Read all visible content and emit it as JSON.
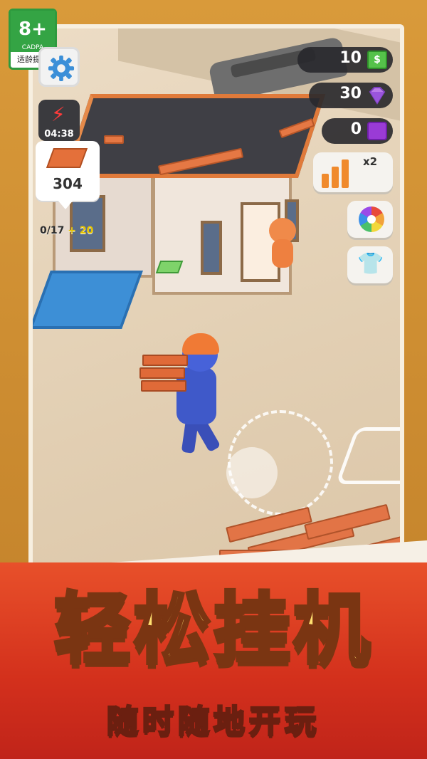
{
  "rating_badge": {
    "age": "8+",
    "org": "CADPA",
    "label": "适龄提示"
  },
  "hud": {
    "energy_timer": "04:38",
    "brick_count": "304",
    "progress": {
      "current_total": "0/17",
      "bonus": "+ 20"
    },
    "cash": "10",
    "gems": "30",
    "tickets": "0",
    "boost_multiplier": "x2"
  },
  "banner": {
    "headline": "轻松挂机",
    "subline": "随时随地开玩"
  },
  "colors": {
    "banner_red": "#d3301c",
    "headline_yellow": "#ffe070",
    "brick_orange": "#e27446",
    "worker_blue": "#3f59c9"
  },
  "icons": [
    "settings-gear-icon",
    "energy-bolt-icon",
    "brick-icon",
    "cash-icon",
    "gem-icon",
    "ticket-icon",
    "boost-bars-icon",
    "spin-wheel-icon",
    "shirt-icon"
  ]
}
